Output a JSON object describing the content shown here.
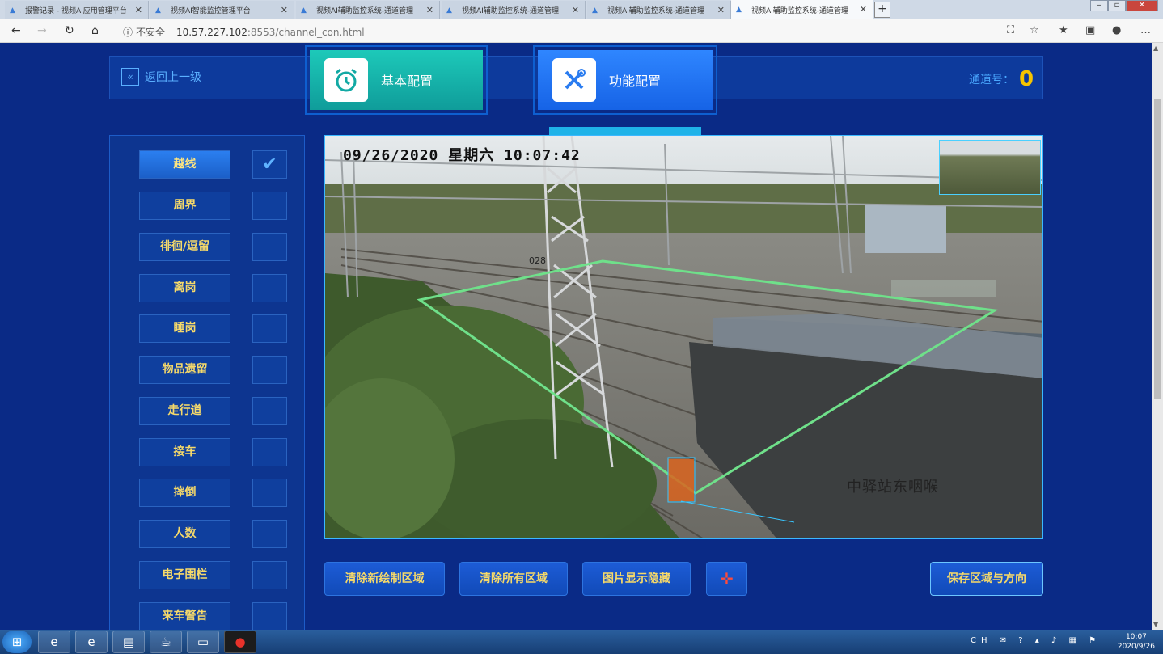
{
  "browser": {
    "tabs": [
      {
        "label": "报警记录 - 视频AI应用管理平台",
        "active": false
      },
      {
        "label": "视频AI智能监控管理平台",
        "active": false
      },
      {
        "label": "视频AI辅助监控系统-通道管理",
        "active": false
      },
      {
        "label": "视频AI辅助监控系统-通道管理",
        "active": false
      },
      {
        "label": "视频AI辅助监控系统-通道管理",
        "active": false
      },
      {
        "label": "视频AI辅助监控系统-通道管理",
        "active": true
      }
    ],
    "new_tab": "+",
    "security": "不安全",
    "url_host": "10.57.227.102",
    "url_path": ":8553/channel_con.html"
  },
  "header": {
    "back_label": "返回上一级",
    "tab_basic": "基本配置",
    "tab_function": "功能配置",
    "channel_label": "通道号：",
    "channel_value": "0"
  },
  "functions": [
    {
      "label": "越线",
      "checked": true
    },
    {
      "label": "周界",
      "checked": false
    },
    {
      "label": "徘徊/逗留",
      "checked": false
    },
    {
      "label": "离岗",
      "checked": false
    },
    {
      "label": "睡岗",
      "checked": false
    },
    {
      "label": "物品遗留",
      "checked": false
    },
    {
      "label": "走行道",
      "checked": false
    },
    {
      "label": "接车",
      "checked": false
    },
    {
      "label": "摔倒",
      "checked": false
    },
    {
      "label": "人数",
      "checked": false
    },
    {
      "label": "电子围栏",
      "checked": false
    },
    {
      "label": "来车警告",
      "checked": false
    }
  ],
  "video": {
    "osd_time": "09/26/2020 星期六 10:07:42",
    "station_text": "中驿站东咽喉",
    "pole_number": "028",
    "region_color": "#6fe08a"
  },
  "buttons": {
    "clear_new": "清除新绘制区域",
    "clear_all": "清除所有区域",
    "toggle_image": "图片显示隐藏",
    "save": "保存区域与方向"
  },
  "taskbar": {
    "lang": "CH",
    "time": "10:07",
    "date": "2020/9/26"
  },
  "colors": {
    "page_bg": "#0a2a86",
    "label_text": "#f5d96a",
    "accent_blue": "#4aa8ff",
    "channel_value": "#f5c400"
  }
}
